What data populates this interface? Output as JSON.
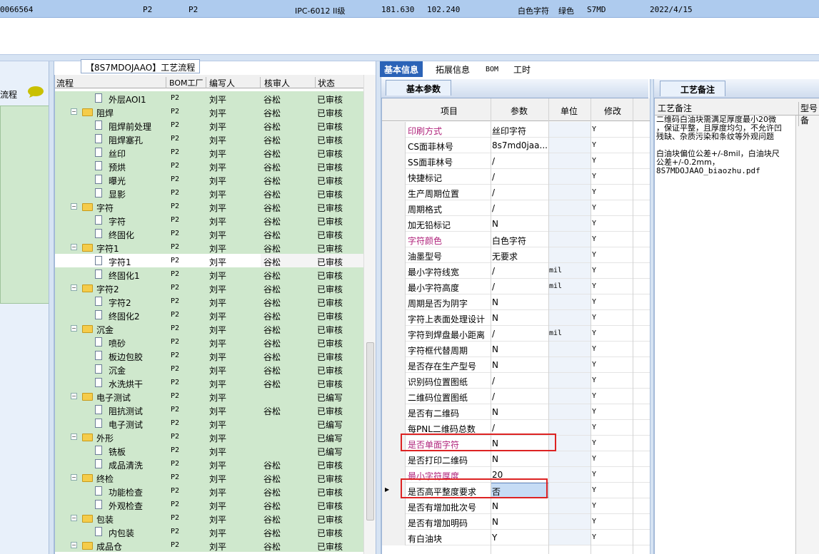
{
  "top_row": {
    "id": "0066564",
    "c1": "P2",
    "c2": "P2",
    "standard": "IPC-6012 II级",
    "v1": "181.630",
    "v2": "102.240",
    "char_color": "白色字符",
    "mask_color": "绿色",
    "stmd": "S7MD",
    "date": "2022/4/15"
  },
  "left_col": {
    "label": "流程"
  },
  "left_title": "【8S7MDOJAAO】工艺流程",
  "tree": {
    "headers": [
      "流程",
      "BOM工厂",
      "编写人",
      "核审人",
      "状态"
    ],
    "rows": [
      {
        "kind": "doc",
        "level": 2,
        "name": "外层AOI1",
        "bom": "P2",
        "writer": "刘平",
        "reviewer": "谷松",
        "status": "已审核"
      },
      {
        "kind": "folder",
        "level": 1,
        "name": "阻焊",
        "bom": "P2",
        "writer": "刘平",
        "reviewer": "谷松",
        "status": "已审核"
      },
      {
        "kind": "doc",
        "level": 2,
        "name": "阻焊前处理",
        "bom": "P2",
        "writer": "刘平",
        "reviewer": "谷松",
        "status": "已审核"
      },
      {
        "kind": "doc",
        "level": 2,
        "name": "阻焊塞孔",
        "bom": "P2",
        "writer": "刘平",
        "reviewer": "谷松",
        "status": "已审核"
      },
      {
        "kind": "doc",
        "level": 2,
        "name": "丝印",
        "bom": "P2",
        "writer": "刘平",
        "reviewer": "谷松",
        "status": "已审核"
      },
      {
        "kind": "doc",
        "level": 2,
        "name": "预烘",
        "bom": "P2",
        "writer": "刘平",
        "reviewer": "谷松",
        "status": "已审核"
      },
      {
        "kind": "doc",
        "level": 2,
        "name": "曝光",
        "bom": "P2",
        "writer": "刘平",
        "reviewer": "谷松",
        "status": "已审核"
      },
      {
        "kind": "doc",
        "level": 2,
        "name": "显影",
        "bom": "P2",
        "writer": "刘平",
        "reviewer": "谷松",
        "status": "已审核"
      },
      {
        "kind": "folder",
        "level": 1,
        "name": "字符",
        "bom": "P2",
        "writer": "刘平",
        "reviewer": "谷松",
        "status": "已审核"
      },
      {
        "kind": "doc",
        "level": 2,
        "name": "字符",
        "bom": "P2",
        "writer": "刘平",
        "reviewer": "谷松",
        "status": "已审核"
      },
      {
        "kind": "doc",
        "level": 2,
        "name": "终固化",
        "bom": "P2",
        "writer": "刘平",
        "reviewer": "谷松",
        "status": "已审核"
      },
      {
        "kind": "folder",
        "level": 1,
        "name": "字符1",
        "bom": "P2",
        "writer": "刘平",
        "reviewer": "谷松",
        "status": "已审核"
      },
      {
        "kind": "doc",
        "level": 2,
        "name": "字符1",
        "bom": "P2",
        "writer": "刘平",
        "reviewer": "谷松",
        "status": "已审核",
        "selected": true
      },
      {
        "kind": "doc",
        "level": 2,
        "name": "终固化1",
        "bom": "P2",
        "writer": "刘平",
        "reviewer": "谷松",
        "status": "已审核"
      },
      {
        "kind": "folder",
        "level": 1,
        "name": "字符2",
        "bom": "P2",
        "writer": "刘平",
        "reviewer": "谷松",
        "status": "已审核"
      },
      {
        "kind": "doc",
        "level": 2,
        "name": "字符2",
        "bom": "P2",
        "writer": "刘平",
        "reviewer": "谷松",
        "status": "已审核"
      },
      {
        "kind": "doc",
        "level": 2,
        "name": "终固化2",
        "bom": "P2",
        "writer": "刘平",
        "reviewer": "谷松",
        "status": "已审核"
      },
      {
        "kind": "folder",
        "level": 1,
        "name": "沉金",
        "bom": "P2",
        "writer": "刘平",
        "reviewer": "谷松",
        "status": "已审核"
      },
      {
        "kind": "doc",
        "level": 2,
        "name": "喷砂",
        "bom": "P2",
        "writer": "刘平",
        "reviewer": "谷松",
        "status": "已审核"
      },
      {
        "kind": "doc",
        "level": 2,
        "name": "板边包胶",
        "bom": "P2",
        "writer": "刘平",
        "reviewer": "谷松",
        "status": "已审核"
      },
      {
        "kind": "doc",
        "level": 2,
        "name": "沉金",
        "bom": "P2",
        "writer": "刘平",
        "reviewer": "谷松",
        "status": "已审核"
      },
      {
        "kind": "doc",
        "level": 2,
        "name": "水洗烘干",
        "bom": "P2",
        "writer": "刘平",
        "reviewer": "谷松",
        "status": "已审核"
      },
      {
        "kind": "folder",
        "level": 1,
        "name": "电子测试",
        "bom": "P2",
        "writer": "刘平",
        "reviewer": "",
        "status": "已编写"
      },
      {
        "kind": "doc",
        "level": 2,
        "name": "阻抗测试",
        "bom": "P2",
        "writer": "刘平",
        "reviewer": "谷松",
        "status": "已审核"
      },
      {
        "kind": "doc",
        "level": 2,
        "name": "电子测试",
        "bom": "P2",
        "writer": "刘平",
        "reviewer": "",
        "status": "已编写"
      },
      {
        "kind": "folder",
        "level": 1,
        "name": "外形",
        "bom": "P2",
        "writer": "刘平",
        "reviewer": "",
        "status": "已编写"
      },
      {
        "kind": "doc",
        "level": 2,
        "name": "铣板",
        "bom": "P2",
        "writer": "刘平",
        "reviewer": "",
        "status": "已编写"
      },
      {
        "kind": "doc",
        "level": 2,
        "name": "成品清洗",
        "bom": "P2",
        "writer": "刘平",
        "reviewer": "谷松",
        "status": "已审核"
      },
      {
        "kind": "folder",
        "level": 1,
        "name": "终检",
        "bom": "P2",
        "writer": "刘平",
        "reviewer": "谷松",
        "status": "已审核"
      },
      {
        "kind": "doc",
        "level": 2,
        "name": "功能检查",
        "bom": "P2",
        "writer": "刘平",
        "reviewer": "谷松",
        "status": "已审核"
      },
      {
        "kind": "doc",
        "level": 2,
        "name": "外观检查",
        "bom": "P2",
        "writer": "刘平",
        "reviewer": "谷松",
        "status": "已审核"
      },
      {
        "kind": "folder",
        "level": 1,
        "name": "包装",
        "bom": "P2",
        "writer": "刘平",
        "reviewer": "谷松",
        "status": "已审核"
      },
      {
        "kind": "doc",
        "level": 2,
        "name": "内包装",
        "bom": "P2",
        "writer": "刘平",
        "reviewer": "谷松",
        "status": "已审核"
      },
      {
        "kind": "folder",
        "level": 1,
        "name": "成品仓",
        "bom": "P2",
        "writer": "刘平",
        "reviewer": "谷松",
        "status": "已审核"
      }
    ]
  },
  "tabs": [
    "基本信息",
    "拓展信息",
    "BOM",
    "工时"
  ],
  "param_tab": "基本参数",
  "grid": {
    "headers": [
      "项目",
      "参数",
      "单位",
      "修改"
    ],
    "rows": [
      {
        "item": "印刷方式",
        "param": "丝印字符",
        "unit": "",
        "mod": "Y",
        "pink": true
      },
      {
        "item": "CS面菲林号",
        "param": "8s7md0jaa...",
        "unit": "",
        "mod": "Y"
      },
      {
        "item": "SS面菲林号",
        "param": "/",
        "unit": "",
        "mod": "Y"
      },
      {
        "item": "快捷标记",
        "param": "/",
        "unit": "",
        "mod": "Y"
      },
      {
        "item": "生产周期位置",
        "param": "/",
        "unit": "",
        "mod": "Y"
      },
      {
        "item": "周期格式",
        "param": "/",
        "unit": "",
        "mod": "Y"
      },
      {
        "item": "加无铅标记",
        "param": "N",
        "unit": "",
        "mod": "Y"
      },
      {
        "item": "字符颜色",
        "param": "白色字符",
        "unit": "",
        "mod": "Y",
        "pink": true
      },
      {
        "item": "油墨型号",
        "param": "无要求",
        "unit": "",
        "mod": "Y"
      },
      {
        "item": "最小字符线宽",
        "param": "/",
        "unit": "mil",
        "mod": "Y"
      },
      {
        "item": "最小字符高度",
        "param": "/",
        "unit": "mil",
        "mod": "Y"
      },
      {
        "item": "周期是否为阴字",
        "param": "N",
        "unit": "",
        "mod": "Y"
      },
      {
        "item": "字符上表面处理设计",
        "param": "N",
        "unit": "",
        "mod": "Y"
      },
      {
        "item": "字符到焊盘最小距离",
        "param": "/",
        "unit": "mil",
        "mod": "Y"
      },
      {
        "item": "字符框代替周期",
        "param": "N",
        "unit": "",
        "mod": "Y"
      },
      {
        "item": "是否存在生产型号",
        "param": "N",
        "unit": "",
        "mod": "Y"
      },
      {
        "item": "识别码位置图纸",
        "param": "/",
        "unit": "",
        "mod": "Y"
      },
      {
        "item": "二维码位置图纸",
        "param": "/",
        "unit": "",
        "mod": "Y"
      },
      {
        "item": "是否有二维码",
        "param": "N",
        "unit": "",
        "mod": "Y"
      },
      {
        "item": "每PNL二维码总数",
        "param": "/",
        "unit": "",
        "mod": "Y"
      },
      {
        "item": "是否单面字符",
        "param": "N",
        "unit": "",
        "mod": "Y",
        "pink": true
      },
      {
        "item": "是否打印二维码",
        "param": "N",
        "unit": "",
        "mod": "Y"
      },
      {
        "item": "最小字符厚度",
        "param": "20",
        "unit": "",
        "mod": "Y",
        "pink": true
      },
      {
        "item": "是否高平整度要求",
        "param": "否",
        "unit": "",
        "mod": "Y",
        "current": true
      },
      {
        "item": "是否有增加批次号",
        "param": "N",
        "unit": "",
        "mod": "Y"
      },
      {
        "item": "是否有增加明码",
        "param": "N",
        "unit": "",
        "mod": "Y"
      },
      {
        "item": "有白油块",
        "param": "Y",
        "unit": "",
        "mod": "Y"
      }
    ]
  },
  "notes": {
    "tab": "工艺备注",
    "header": "工艺备注",
    "header2": "型号备",
    "lines": [
      "二维码白油块需满足厚度最小20微",
      "，保证平整，且厚度均匀，不允许凹",
      "残缺、杂质污染和条纹等外观问题",
      "",
      "白油块偏位公差+/-8mil，白油块尺",
      "公差+/-0.2mm，",
      "8S7MDOJAAO_biaozhu.pdf"
    ]
  },
  "colors": {
    "accent": "#2b63b7",
    "tree_green": "#cfe8cd",
    "highlight_box": "#dd2222",
    "pink_text": "#b0237b",
    "top_row": "#aecbee"
  }
}
